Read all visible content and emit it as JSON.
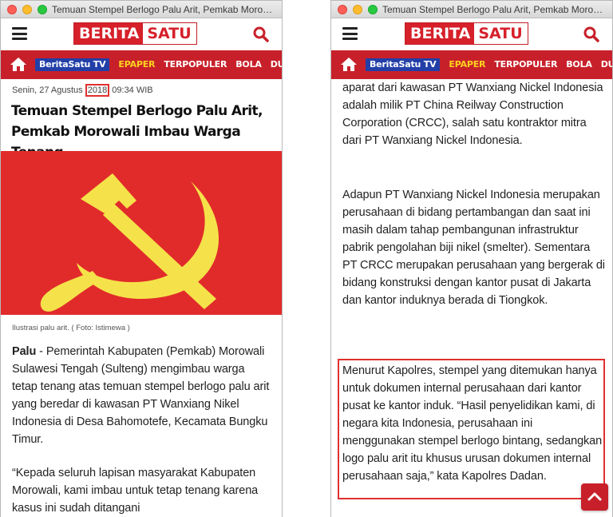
{
  "windows": {
    "left": {
      "title": "Temuan Stempel Berlogo Palu Arit, Pemkab Morowali I...",
      "header": {
        "logo_part1": "BERITA",
        "logo_part2": "SATU"
      },
      "nav": [
        "BeritaSatu TV",
        "EPAPER",
        "TERPOPULER",
        "BOLA",
        "DUNIA"
      ],
      "date_prefix": "Senin, 27 Agustus ",
      "date_year": "2018",
      "date_suffix": " 09:34 WIB",
      "headline": "Temuan Stempel Berlogo Palu Arit, Pemkab Morowali Imbau Warga Tenang",
      "caption": "Ilustrasi palu arit. ( Foto: Istimewa )",
      "para1_lead": "Palu",
      "para1_text": " - Pemerintah Kabupaten (Pemkab) Morowali Sulawesi Tengah (Sulteng) mengimbau warga tetap tenang atas temuan stempel berlogo palu arit yang beredar di kawasan PT Wanxiang Nikel Indonesia di Desa Bahomotefe, Kecamata Bungku Timur.",
      "para2": "“Kepada seluruh lapisan masyarakat Kabupaten Morowali, kami imbau untuk tetap tenang karena kasus ini sudah ditangani"
    },
    "right": {
      "title": "Temuan Stempel Berlogo Palu Arit, Pemkab Morowali I...",
      "header": {
        "logo_part1": "BERITA",
        "logo_part2": "SATU"
      },
      "nav": [
        "BeritaSatu TV",
        "EPAPER",
        "TERPOPULER",
        "BOLA",
        "DUNIA"
      ],
      "para1": "aparat dari kawasan PT Wanxiang Nickel Indonesia adalah milik PT China Reilway Construction Corporation (CRCC), salah satu kontraktor mitra dari PT Wanxiang Nickel Indonesia.",
      "para2": "Adapun PT Wanxiang Nickel Indonesia merupakan perusahaan di bidang pertambangan dan saat ini masih dalam tahap pembangunan infrastruktur pabrik pengolahan biji nikel (smelter). Sementara PT CRCC merupakan perusahaan yang bergerak di bidang konstruksi dengan kantor pusat di Jakarta dan kantor induknya berada di Tiongkok.",
      "para3": "Menurut Kapolres, stempel yang ditemukan hanya untuk dokumen internal perusahaan dari kantor pusat ke kantor induk. “Hasil penyelidikan kami, di negara kita Indonesia, perusahaan ini menggunakan stempel berlogo bintang, sedangkan logo palu arit itu khusus urusan dokumen internal perusahaan saja,” kata Kapolres Dadan."
    }
  },
  "colors": {
    "brand_red": "#c8202a",
    "logo_red": "#d6202a",
    "tv_blue": "#223fa8",
    "epaper_yellow": "#ffd21f",
    "highlight_red": "#e03030",
    "hero_red": "#e12b2b",
    "hammer_sickle_yellow": "#f5e24a"
  },
  "icons": {
    "menu": "hamburger-icon",
    "search": "search-icon",
    "home": "home-icon",
    "scroll_top": "chevron-up-icon"
  }
}
